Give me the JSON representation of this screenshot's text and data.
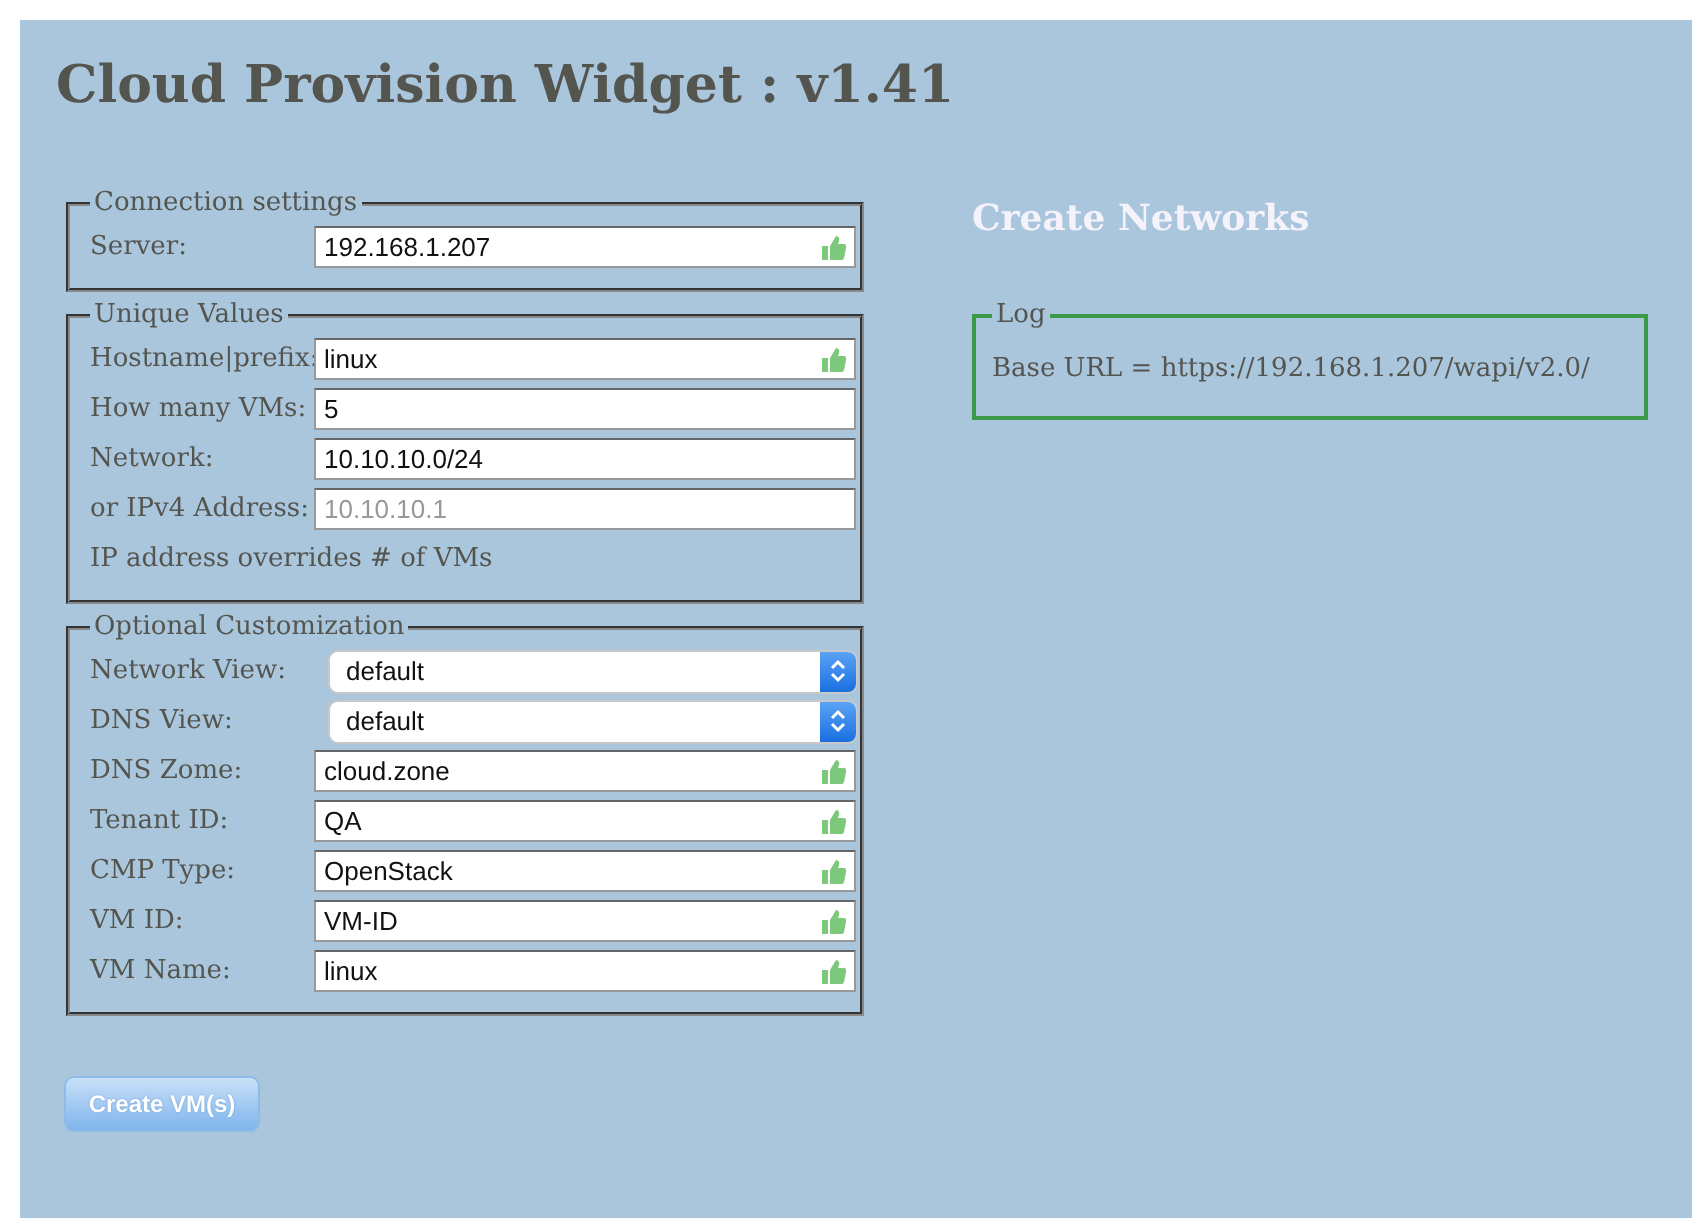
{
  "title": "Cloud Provision Widget : v1.41",
  "sections": [
    {
      "legend": "Connection settings",
      "rows": [
        {
          "kind": "text",
          "label": "Server:",
          "value": "192.168.1.207",
          "validated": true
        }
      ]
    },
    {
      "legend": "Unique Values",
      "rows": [
        {
          "kind": "text",
          "label": "Hostname|prefix:",
          "value": "linux",
          "validated": true
        },
        {
          "kind": "text",
          "label": "How many VMs:",
          "value": "5",
          "validated": false
        },
        {
          "kind": "text",
          "label": "Network:",
          "value": "10.10.10.0/24",
          "validated": false
        },
        {
          "kind": "text",
          "label": "or IPv4 Address:",
          "placeholder": "10.10.10.1",
          "validated": false
        },
        {
          "kind": "note",
          "label": "IP address overrides # of VMs"
        }
      ]
    },
    {
      "legend": "Optional Customization",
      "rows": [
        {
          "kind": "select",
          "label": "Network View:",
          "value": "default"
        },
        {
          "kind": "select",
          "label": "DNS View:",
          "value": "default"
        },
        {
          "kind": "text",
          "label": "DNS Zome:",
          "value": "cloud.zone",
          "validated": true
        },
        {
          "kind": "text",
          "label": "Tenant ID:",
          "value": "QA",
          "validated": true
        },
        {
          "kind": "text",
          "label": "CMP Type:",
          "value": "OpenStack",
          "validated": true
        },
        {
          "kind": "text",
          "label": "VM ID:",
          "value": "VM-ID",
          "validated": true
        },
        {
          "kind": "text",
          "label": "VM Name:",
          "value": "linux",
          "validated": true
        }
      ]
    }
  ],
  "submit_button": "Create VM(s)",
  "networks_heading": "Create Networks",
  "log": {
    "legend": "Log",
    "lines": [
      "Base URL = https://192.168.1.207/wapi/v2.0/"
    ]
  }
}
